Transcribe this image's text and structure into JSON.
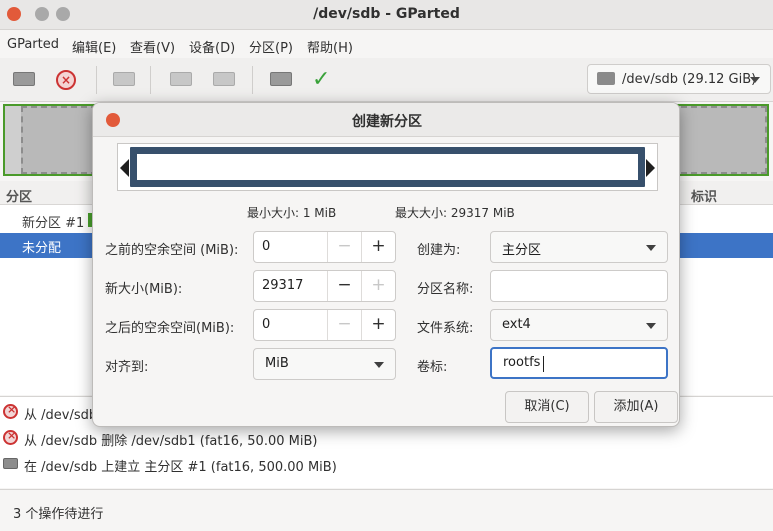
{
  "window": {
    "title": "/dev/sdb - GParted"
  },
  "menubar": [
    "GParted",
    "编辑(E)",
    "查看(V)",
    "设备(D)",
    "分区(P)",
    "帮助(H)"
  ],
  "toolbar": {
    "device_selector": "/dev/sdb (29.12 GiB)"
  },
  "partition_list": {
    "col_partition": "分区",
    "col_label": "标识",
    "rows": [
      "新分区 #1",
      "未分配"
    ]
  },
  "pending_ops": [
    "从 /dev/sdb",
    "从 /dev/sdb 删除 /dev/sdb1 (fat16, 50.00 MiB)",
    "在 /dev/sdb 上建立 主分区 #1 (fat16, 500.00 MiB)"
  ],
  "status": "3 个操作待进行",
  "dialog": {
    "title": "创建新分区",
    "min_size": "最小大小: 1 MiB",
    "max_size": "最大大小: 29317 MiB",
    "free_before_label": "之前的空余空间 (MiB):",
    "free_before_value": "0",
    "new_size_label": "新大小(MiB):",
    "new_size_value": "29317",
    "free_after_label": "之后的空余空间(MiB):",
    "free_after_value": "0",
    "align_label": "对齐到:",
    "align_value": "MiB",
    "create_as_label": "创建为:",
    "create_as_value": "主分区",
    "partition_name_label": "分区名称:",
    "partition_name_value": "",
    "filesystem_label": "文件系统:",
    "filesystem_value": "ext4",
    "volume_label_label": "卷标:",
    "volume_label_value": "rootfs",
    "minus": "−",
    "plus": "+",
    "cancel": "取消(C)",
    "add": "添加(A)"
  }
}
